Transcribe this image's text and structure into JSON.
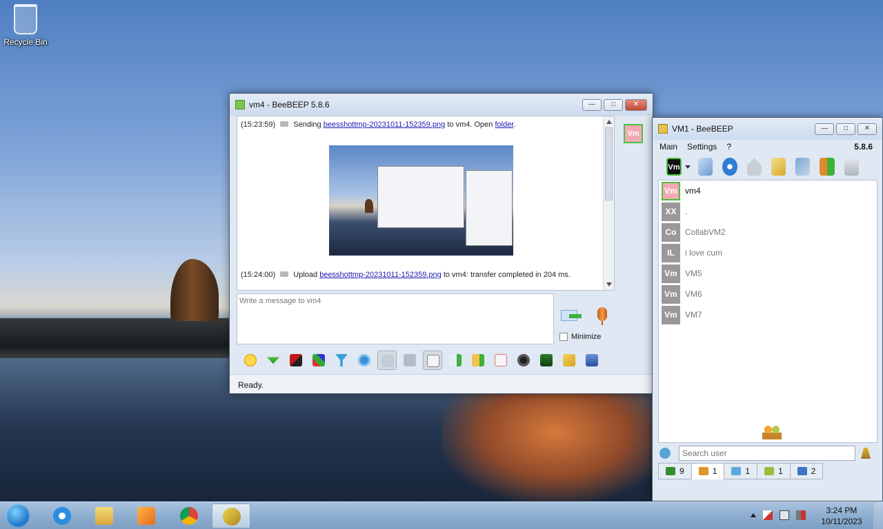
{
  "desktop": {
    "recycle_bin_label": "Recycle Bin"
  },
  "chat_window": {
    "title": "vm4 - BeeBEEP 5.8.6",
    "avatar_text": "Vm",
    "messages": {
      "m1_time": "(15:23:59)",
      "m1_prefix": "Sending",
      "m1_file": "beesshottmp-20231011-152359.png",
      "m1_mid": "to vm4. Open",
      "m1_link": "folder",
      "m1_end": ".",
      "m2_time": "(15:24:00)",
      "m2_prefix": "Upload",
      "m2_file": "beesshottmp-20231011-152359.png",
      "m2_rest": "to vm4: transfer completed in 204 ms."
    },
    "input_placeholder": "Write a message to vm4",
    "minimize_label": "Minimize",
    "status": "Ready.",
    "toolbar_icons": [
      "emoticon-icon",
      "down-arrow-icon",
      "font-icon",
      "color-icon",
      "filter-icon",
      "settings-icon",
      "spellcheck-icon",
      "word-complete-icon",
      "return-key-icon",
      "send-file-icon",
      "send-folder-icon",
      "html-icon",
      "screenshot-icon",
      "save-chat-icon",
      "edit-icon",
      "save-icon"
    ]
  },
  "main_window": {
    "title": "VM1 - BeeBEEP",
    "menu": [
      "Main",
      "Settings",
      "?"
    ],
    "version": "5.8.6",
    "vm_button": "Vm",
    "users": [
      {
        "avatar": "Vm",
        "name": "vm4",
        "online": true
      },
      {
        "avatar": "XX",
        "name": ".",
        "online": false
      },
      {
        "avatar": "Co",
        "name": "CollabVM2",
        "online": false
      },
      {
        "avatar": "IL",
        "name": "i love cum",
        "online": false
      },
      {
        "avatar": "Vm",
        "name": "VM5",
        "online": false
      },
      {
        "avatar": "Vm",
        "name": "VM6",
        "online": false
      },
      {
        "avatar": "Vm",
        "name": "VM7",
        "online": false
      }
    ],
    "search_placeholder": "Search user",
    "tabs": [
      {
        "label": "9",
        "icon": "chat-icon"
      },
      {
        "label": "1",
        "icon": "users-icon"
      },
      {
        "label": "1",
        "icon": "groups-icon"
      },
      {
        "label": "1",
        "icon": "group-icon"
      },
      {
        "label": "2",
        "icon": "share-icon"
      }
    ]
  },
  "taskbar": {
    "time": "3:24 PM",
    "date": "10/11/2023",
    "apps": [
      "internet-explorer-icon",
      "file-explorer-icon",
      "media-player-icon",
      "chrome-icon",
      "beebeep-icon"
    ]
  },
  "colors": {
    "online_border": "#49c23e",
    "avatar_pink": "#f4a9b5",
    "link": "#1b1ab0"
  }
}
